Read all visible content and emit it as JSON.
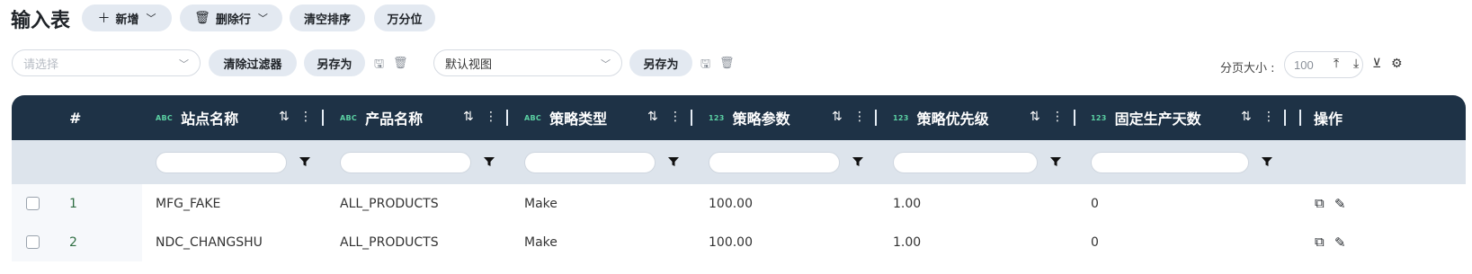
{
  "toolbar": {
    "title": "输入表",
    "add_label": "新增",
    "delete_row_label": "删除行",
    "clear_sort_label": "清空排序",
    "thousands_label": "万分位"
  },
  "filterbar": {
    "filter_select_placeholder": "请选择",
    "clear_filter_label": "清除过滤器",
    "save_as_label_1": "另存为",
    "view_select_value": "默认视图",
    "save_as_label_2": "另存为",
    "page_size_label": "分页大小 :",
    "page_size_value": "100"
  },
  "table": {
    "index_header": "#",
    "columns": [
      {
        "type": "ABC",
        "label": "站点名称"
      },
      {
        "type": "ABC",
        "label": "产品名称"
      },
      {
        "type": "ABC",
        "label": "策略类型"
      },
      {
        "type": "123",
        "label": "策略参数"
      },
      {
        "type": "123",
        "label": "策略优先级"
      },
      {
        "type": "123",
        "label": "固定生产天数"
      }
    ],
    "action_header": "操作",
    "rows": [
      {
        "num": "1",
        "cells": [
          "MFG_FAKE",
          "ALL_PRODUCTS",
          "Make",
          "100.00",
          "1.00",
          "0"
        ]
      },
      {
        "num": "2",
        "cells": [
          "NDC_CHANGSHU",
          "ALL_PRODUCTS",
          "Make",
          "100.00",
          "1.00",
          "0"
        ]
      }
    ]
  },
  "icons": {
    "plus": "plus-icon",
    "trash": "trash-icon",
    "chevron": "chevron-down-icon",
    "save": "save-icon",
    "upload": "upload-icon",
    "download": "download-icon",
    "column_toggle": "column-toggle-icon",
    "settings": "gear-icon",
    "sort": "sort-icon",
    "menu": "more-vertical-icon",
    "filter": "funnel-icon",
    "copy": "copy-icon",
    "edit": "edit-icon"
  },
  "colors": {
    "header_bg": "#1e3246",
    "filter_row_bg": "#dde4ec",
    "pill_bg": "#e3e9f1",
    "type_badge": "#5bd1a3",
    "row_number": "#2f6e43"
  }
}
